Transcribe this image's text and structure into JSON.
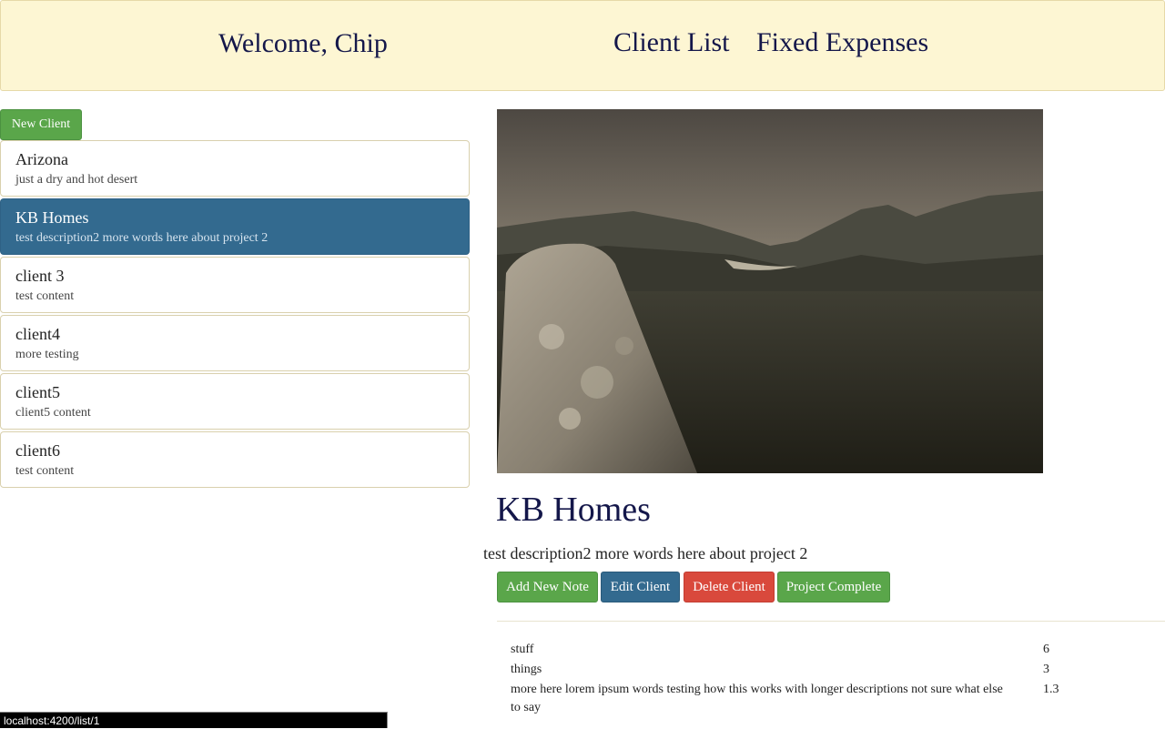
{
  "header": {
    "welcome": "Welcome, Chip",
    "nav": [
      "Client List",
      "Fixed Expenses"
    ]
  },
  "sidebar": {
    "new_client_label": "New Client",
    "clients": [
      {
        "name": "Arizona",
        "description": "just a dry and hot desert"
      },
      {
        "name": "KB Homes",
        "description": "test description2 more words here about project 2"
      },
      {
        "name": "client 3",
        "description": "test content"
      },
      {
        "name": "client4",
        "description": "more testing"
      },
      {
        "name": "client5",
        "description": "client5 content"
      },
      {
        "name": "client6",
        "description": "test content"
      }
    ],
    "selected_index": 1
  },
  "detail": {
    "title": "KB Homes",
    "description": "test description2 more words here about project 2",
    "actions": {
      "add_note": "Add New Note",
      "edit": "Edit Client",
      "delete": "Delete Client",
      "complete": "Project Complete"
    },
    "notes": [
      {
        "text": "stuff",
        "value": "6"
      },
      {
        "text": "things",
        "value": "3"
      },
      {
        "text": "more here lorem ipsum words testing how this works with longer descriptions not sure what else to say",
        "value": "1.3"
      }
    ]
  },
  "status_bar": {
    "url": "localhost:4200/list/1"
  },
  "colors": {
    "header_bg": "#fdf6d3",
    "nav_text": "#14174a",
    "primary_blue": "#336a8f",
    "success_green": "#5aa64a",
    "danger_red": "#d9493c"
  }
}
